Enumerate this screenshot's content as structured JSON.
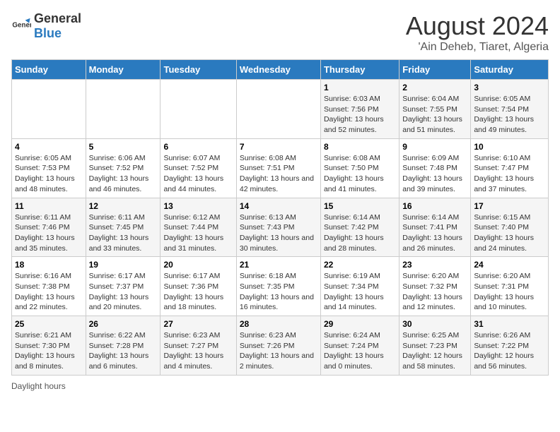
{
  "logo": {
    "general": "General",
    "blue": "Blue"
  },
  "title": "August 2024",
  "subtitle": "'Ain Deheb, Tiaret, Algeria",
  "days_of_week": [
    "Sunday",
    "Monday",
    "Tuesday",
    "Wednesday",
    "Thursday",
    "Friday",
    "Saturday"
  ],
  "footer": {
    "daylight_label": "Daylight hours"
  },
  "weeks": [
    [
      {
        "day": "",
        "sunrise": "",
        "sunset": "",
        "daylight": ""
      },
      {
        "day": "",
        "sunrise": "",
        "sunset": "",
        "daylight": ""
      },
      {
        "day": "",
        "sunrise": "",
        "sunset": "",
        "daylight": ""
      },
      {
        "day": "",
        "sunrise": "",
        "sunset": "",
        "daylight": ""
      },
      {
        "day": "1",
        "sunrise": "Sunrise: 6:03 AM",
        "sunset": "Sunset: 7:56 PM",
        "daylight": "Daylight: 13 hours and 52 minutes."
      },
      {
        "day": "2",
        "sunrise": "Sunrise: 6:04 AM",
        "sunset": "Sunset: 7:55 PM",
        "daylight": "Daylight: 13 hours and 51 minutes."
      },
      {
        "day": "3",
        "sunrise": "Sunrise: 6:05 AM",
        "sunset": "Sunset: 7:54 PM",
        "daylight": "Daylight: 13 hours and 49 minutes."
      }
    ],
    [
      {
        "day": "4",
        "sunrise": "Sunrise: 6:05 AM",
        "sunset": "Sunset: 7:53 PM",
        "daylight": "Daylight: 13 hours and 48 minutes."
      },
      {
        "day": "5",
        "sunrise": "Sunrise: 6:06 AM",
        "sunset": "Sunset: 7:52 PM",
        "daylight": "Daylight: 13 hours and 46 minutes."
      },
      {
        "day": "6",
        "sunrise": "Sunrise: 6:07 AM",
        "sunset": "Sunset: 7:52 PM",
        "daylight": "Daylight: 13 hours and 44 minutes."
      },
      {
        "day": "7",
        "sunrise": "Sunrise: 6:08 AM",
        "sunset": "Sunset: 7:51 PM",
        "daylight": "Daylight: 13 hours and 42 minutes."
      },
      {
        "day": "8",
        "sunrise": "Sunrise: 6:08 AM",
        "sunset": "Sunset: 7:50 PM",
        "daylight": "Daylight: 13 hours and 41 minutes."
      },
      {
        "day": "9",
        "sunrise": "Sunrise: 6:09 AM",
        "sunset": "Sunset: 7:48 PM",
        "daylight": "Daylight: 13 hours and 39 minutes."
      },
      {
        "day": "10",
        "sunrise": "Sunrise: 6:10 AM",
        "sunset": "Sunset: 7:47 PM",
        "daylight": "Daylight: 13 hours and 37 minutes."
      }
    ],
    [
      {
        "day": "11",
        "sunrise": "Sunrise: 6:11 AM",
        "sunset": "Sunset: 7:46 PM",
        "daylight": "Daylight: 13 hours and 35 minutes."
      },
      {
        "day": "12",
        "sunrise": "Sunrise: 6:11 AM",
        "sunset": "Sunset: 7:45 PM",
        "daylight": "Daylight: 13 hours and 33 minutes."
      },
      {
        "day": "13",
        "sunrise": "Sunrise: 6:12 AM",
        "sunset": "Sunset: 7:44 PM",
        "daylight": "Daylight: 13 hours and 31 minutes."
      },
      {
        "day": "14",
        "sunrise": "Sunrise: 6:13 AM",
        "sunset": "Sunset: 7:43 PM",
        "daylight": "Daylight: 13 hours and 30 minutes."
      },
      {
        "day": "15",
        "sunrise": "Sunrise: 6:14 AM",
        "sunset": "Sunset: 7:42 PM",
        "daylight": "Daylight: 13 hours and 28 minutes."
      },
      {
        "day": "16",
        "sunrise": "Sunrise: 6:14 AM",
        "sunset": "Sunset: 7:41 PM",
        "daylight": "Daylight: 13 hours and 26 minutes."
      },
      {
        "day": "17",
        "sunrise": "Sunrise: 6:15 AM",
        "sunset": "Sunset: 7:40 PM",
        "daylight": "Daylight: 13 hours and 24 minutes."
      }
    ],
    [
      {
        "day": "18",
        "sunrise": "Sunrise: 6:16 AM",
        "sunset": "Sunset: 7:38 PM",
        "daylight": "Daylight: 13 hours and 22 minutes."
      },
      {
        "day": "19",
        "sunrise": "Sunrise: 6:17 AM",
        "sunset": "Sunset: 7:37 PM",
        "daylight": "Daylight: 13 hours and 20 minutes."
      },
      {
        "day": "20",
        "sunrise": "Sunrise: 6:17 AM",
        "sunset": "Sunset: 7:36 PM",
        "daylight": "Daylight: 13 hours and 18 minutes."
      },
      {
        "day": "21",
        "sunrise": "Sunrise: 6:18 AM",
        "sunset": "Sunset: 7:35 PM",
        "daylight": "Daylight: 13 hours and 16 minutes."
      },
      {
        "day": "22",
        "sunrise": "Sunrise: 6:19 AM",
        "sunset": "Sunset: 7:34 PM",
        "daylight": "Daylight: 13 hours and 14 minutes."
      },
      {
        "day": "23",
        "sunrise": "Sunrise: 6:20 AM",
        "sunset": "Sunset: 7:32 PM",
        "daylight": "Daylight: 13 hours and 12 minutes."
      },
      {
        "day": "24",
        "sunrise": "Sunrise: 6:20 AM",
        "sunset": "Sunset: 7:31 PM",
        "daylight": "Daylight: 13 hours and 10 minutes."
      }
    ],
    [
      {
        "day": "25",
        "sunrise": "Sunrise: 6:21 AM",
        "sunset": "Sunset: 7:30 PM",
        "daylight": "Daylight: 13 hours and 8 minutes."
      },
      {
        "day": "26",
        "sunrise": "Sunrise: 6:22 AM",
        "sunset": "Sunset: 7:28 PM",
        "daylight": "Daylight: 13 hours and 6 minutes."
      },
      {
        "day": "27",
        "sunrise": "Sunrise: 6:23 AM",
        "sunset": "Sunset: 7:27 PM",
        "daylight": "Daylight: 13 hours and 4 minutes."
      },
      {
        "day": "28",
        "sunrise": "Sunrise: 6:23 AM",
        "sunset": "Sunset: 7:26 PM",
        "daylight": "Daylight: 13 hours and 2 minutes."
      },
      {
        "day": "29",
        "sunrise": "Sunrise: 6:24 AM",
        "sunset": "Sunset: 7:24 PM",
        "daylight": "Daylight: 13 hours and 0 minutes."
      },
      {
        "day": "30",
        "sunrise": "Sunrise: 6:25 AM",
        "sunset": "Sunset: 7:23 PM",
        "daylight": "Daylight: 12 hours and 58 minutes."
      },
      {
        "day": "31",
        "sunrise": "Sunrise: 6:26 AM",
        "sunset": "Sunset: 7:22 PM",
        "daylight": "Daylight: 12 hours and 56 minutes."
      }
    ]
  ]
}
